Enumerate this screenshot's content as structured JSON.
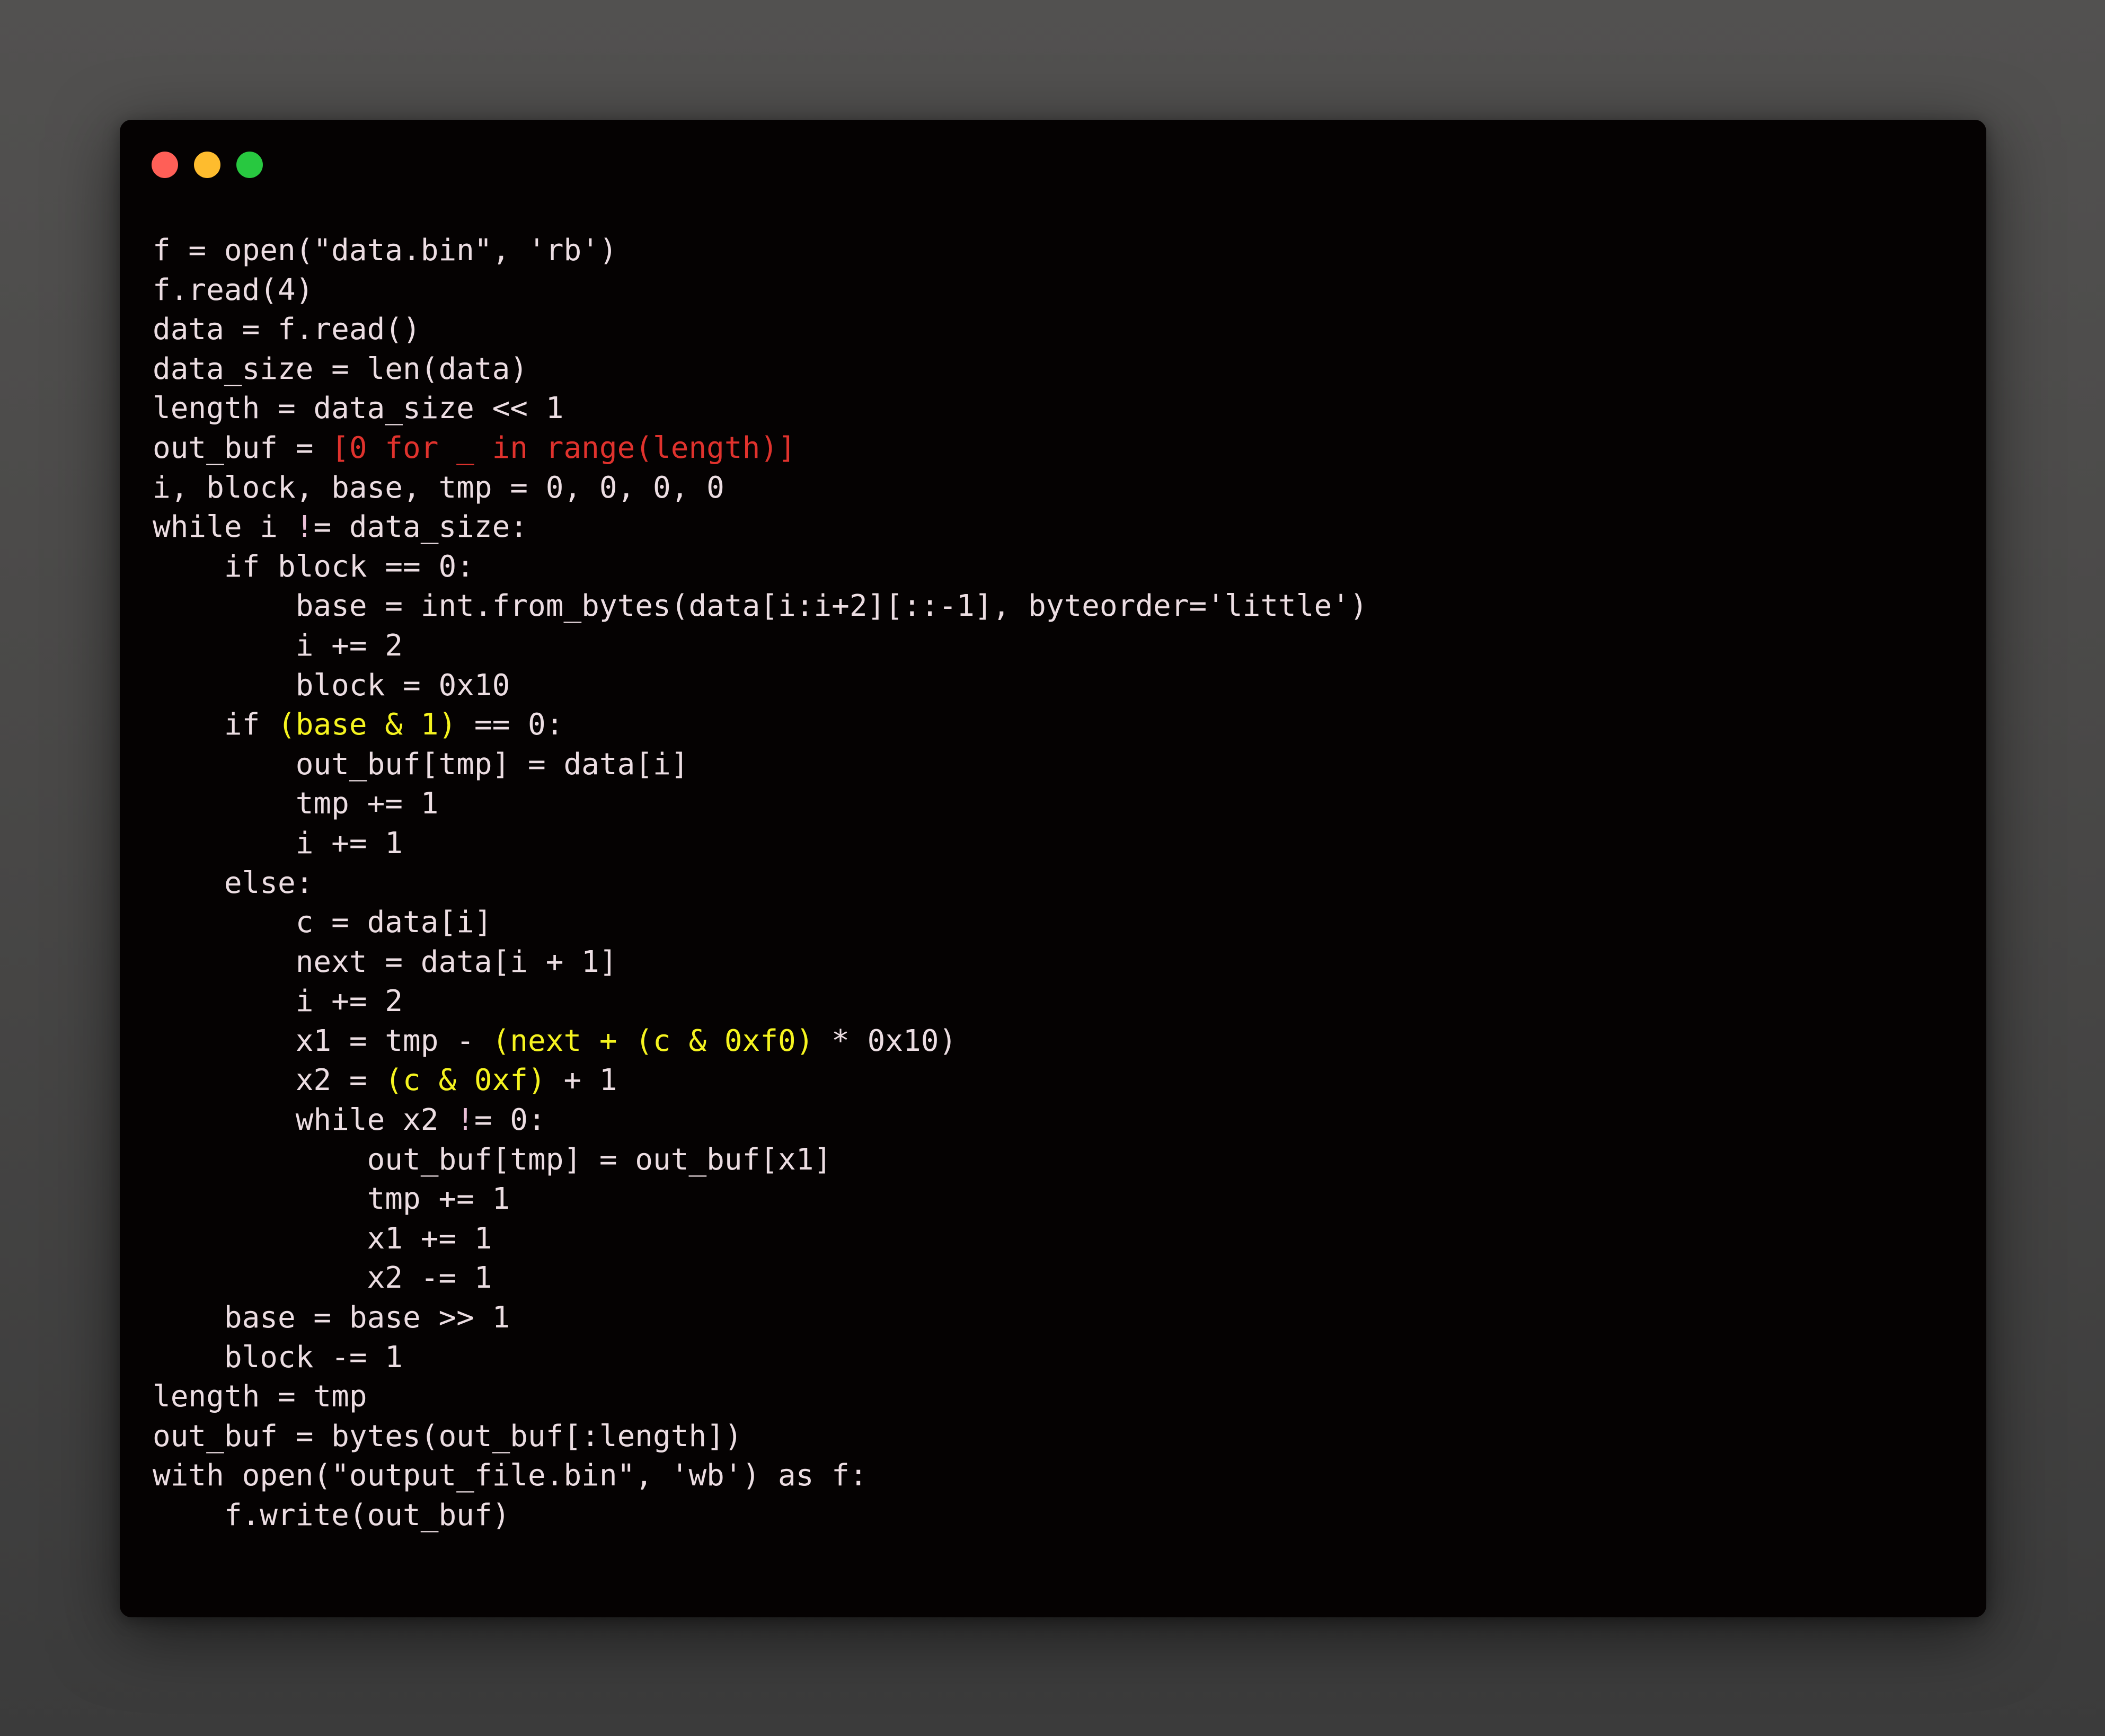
{
  "window": {
    "controls": [
      {
        "name": "close-button",
        "color": "#ff5f57"
      },
      {
        "name": "minimize-button",
        "color": "#febc2e"
      },
      {
        "name": "maximize-button",
        "color": "#28c840"
      }
    ]
  },
  "colors": {
    "default": "#ecdde2",
    "red": "#e0322d",
    "yellow": "#f5f31f",
    "pink": "#e9bfd6",
    "background": "#050202"
  },
  "code": [
    [
      {
        "t": "f = open(\"data.bin\", 'rb')"
      }
    ],
    [
      {
        "t": "f.read(4)"
      }
    ],
    [
      {
        "t": "data = f.read()"
      }
    ],
    [
      {
        "t": "data_size = len(data)"
      }
    ],
    [
      {
        "t": "length = data_size << 1"
      }
    ],
    [
      {
        "t": "out_buf = "
      },
      {
        "t": "[0 for _ in range(length)]",
        "c": "red"
      }
    ],
    [
      {
        "t": "i, block, base, tmp = 0, 0, 0, 0"
      }
    ],
    [
      {
        "t": "while i "
      },
      {
        "t": "!",
        "c": "pink"
      },
      {
        "t": "= data_size:"
      }
    ],
    [
      {
        "t": "    if block == 0:"
      }
    ],
    [
      {
        "t": "        base = int.from_bytes(data[i:i+2][::-1], byteorder='little')"
      }
    ],
    [
      {
        "t": "        i += 2"
      }
    ],
    [
      {
        "t": "        block = 0x10"
      }
    ],
    [
      {
        "t": "    if "
      },
      {
        "t": "(base & 1)",
        "c": "yellow"
      },
      {
        "t": " == 0:"
      }
    ],
    [
      {
        "t": "        out_buf[tmp] = data[i]"
      }
    ],
    [
      {
        "t": "        tmp += 1"
      }
    ],
    [
      {
        "t": "        i += 1"
      }
    ],
    [
      {
        "t": "    else:"
      }
    ],
    [
      {
        "t": "        c = data[i]"
      }
    ],
    [
      {
        "t": "        next = data[i + 1]"
      }
    ],
    [
      {
        "t": "        i += 2"
      }
    ],
    [
      {
        "t": "        x1 = tmp - "
      },
      {
        "t": "(next + (c & 0xf0)",
        "c": "yellow"
      },
      {
        "t": " * 0x10)"
      }
    ],
    [
      {
        "t": "        x2 = "
      },
      {
        "t": "(c & 0xf)",
        "c": "yellow"
      },
      {
        "t": " + 1"
      }
    ],
    [
      {
        "t": "        while x2 "
      },
      {
        "t": "!",
        "c": "pink"
      },
      {
        "t": "= 0:"
      }
    ],
    [
      {
        "t": "            out_buf[tmp] = out_buf[x1]"
      }
    ],
    [
      {
        "t": "            tmp += 1"
      }
    ],
    [
      {
        "t": "            x1 += 1"
      }
    ],
    [
      {
        "t": "            x2 -= 1"
      }
    ],
    [
      {
        "t": "    base = base >> 1"
      }
    ],
    [
      {
        "t": "    block -= 1"
      }
    ],
    [
      {
        "t": "length = tmp"
      }
    ],
    [
      {
        "t": "out_buf = bytes(out_buf[:length])"
      }
    ],
    [
      {
        "t": "with open(\"output_file.bin\", 'wb') as f:"
      }
    ],
    [
      {
        "t": "    f.write(out_buf)"
      }
    ]
  ]
}
